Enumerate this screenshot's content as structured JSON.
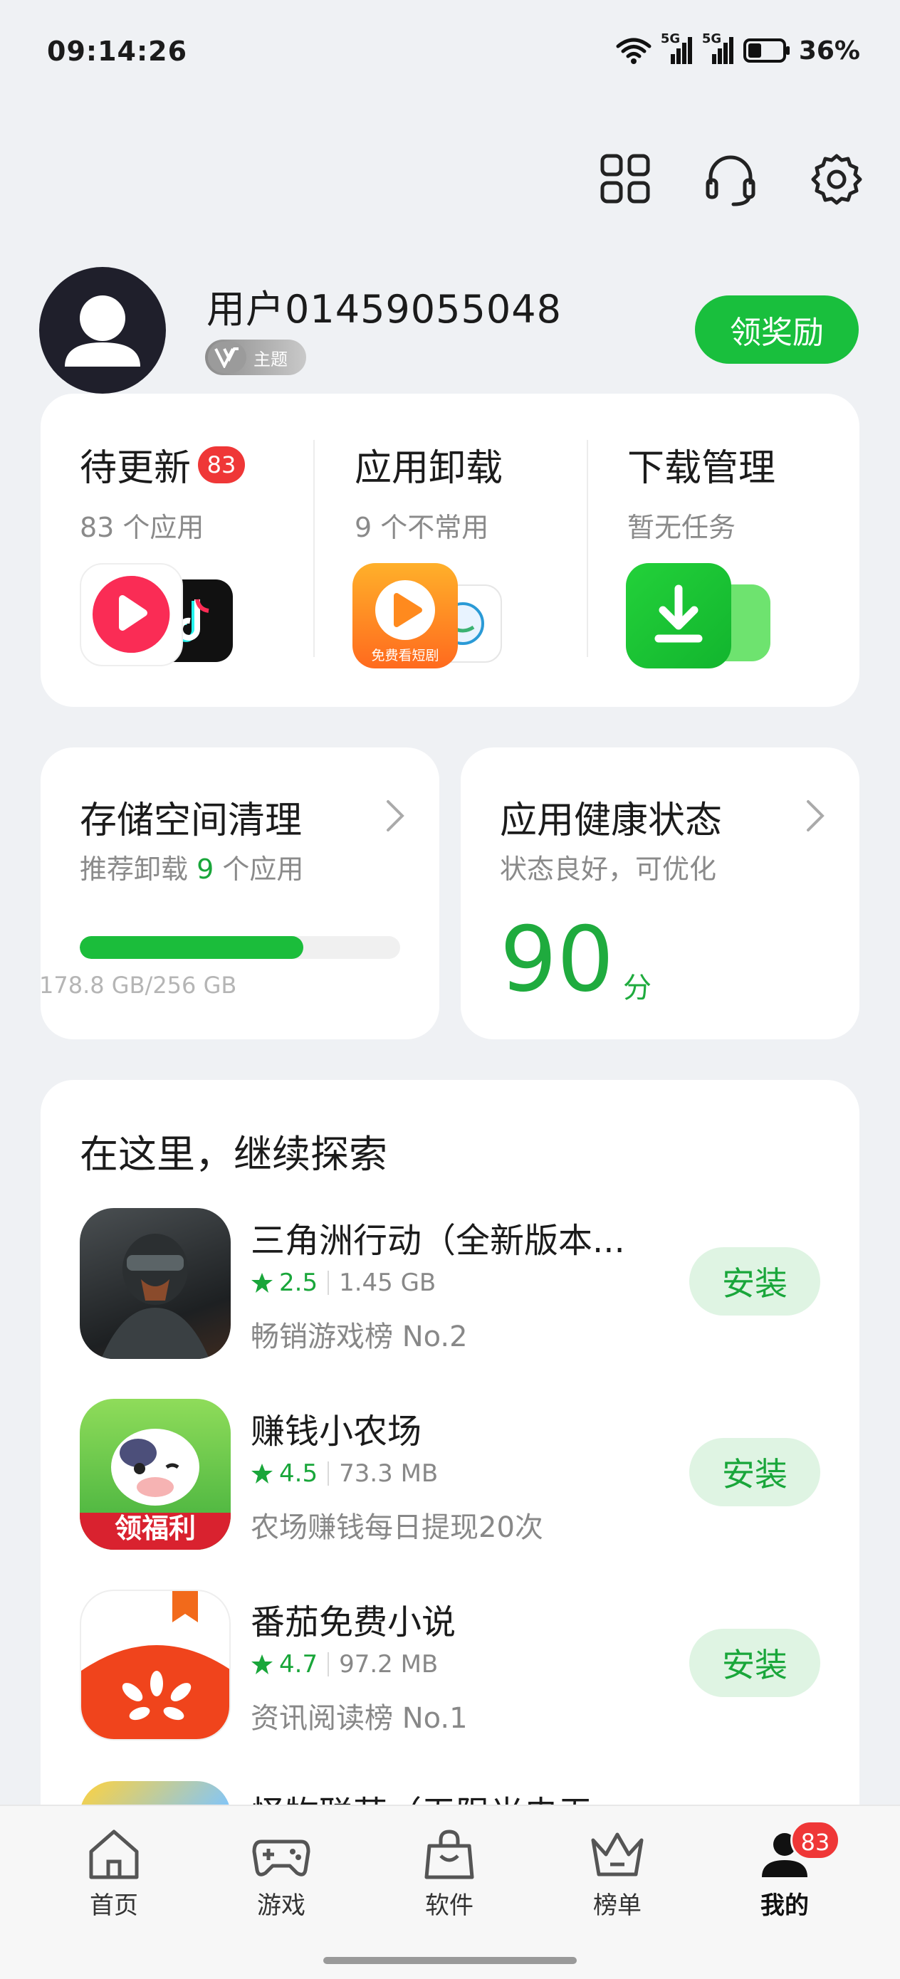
{
  "status_bar": {
    "time": "09:14:26",
    "network_1": "5G",
    "network_2": "5G",
    "battery": "36%"
  },
  "top_actions": {
    "icons": [
      "apps-grid-icon",
      "headset-icon",
      "settings-gear-icon"
    ]
  },
  "profile": {
    "username": "用户01459055048",
    "theme_badge": "主题",
    "reward_button": "领奖励"
  },
  "app_cards": [
    {
      "title": "待更新",
      "badge": "83",
      "subtitle": "83 个应用"
    },
    {
      "title": "应用卸载",
      "subtitle": "9 个不常用",
      "icon_caption": "免费看短剧"
    },
    {
      "title": "下载管理",
      "subtitle": "暂无任务"
    }
  ],
  "storage": {
    "title": "存储空间清理",
    "subtitle_prefix": "推荐卸载 ",
    "count": "9",
    "subtitle_suffix": " 个应用",
    "usage": "178.8 GB/256 GB",
    "used_fraction": 0.698
  },
  "health": {
    "title": "应用健康状态",
    "subtitle": "状态良好，可优化",
    "score": "90",
    "unit": "分"
  },
  "explore": {
    "title": "在这里，继续探索",
    "items": [
      {
        "name": "三角洲行动（全新版本...",
        "rating": "2.5",
        "size": "1.45 GB",
        "desc": "畅销游戏榜 No.2",
        "button": "安装"
      },
      {
        "name": "赚钱小农场",
        "rating": "4.5",
        "size": "73.3 MB",
        "desc": "农场赚钱每日提现20次",
        "button": "安装",
        "icon_caption": "领福利"
      },
      {
        "name": "番茄免费小说",
        "rating": "4.7",
        "size": "97.2 MB",
        "desc": "资讯阅读榜 No.1",
        "button": "安装"
      },
      {
        "name": "怪物联萌（无限光电无..."
      }
    ]
  },
  "nav": [
    {
      "label": "首页",
      "icon": "home-icon"
    },
    {
      "label": "游戏",
      "icon": "gamepad-icon"
    },
    {
      "label": "软件",
      "icon": "shopping-bag-icon"
    },
    {
      "label": "榜单",
      "icon": "crown-icon"
    },
    {
      "label": "我的",
      "icon": "user-icon",
      "badge": "83",
      "active": true
    }
  ]
}
